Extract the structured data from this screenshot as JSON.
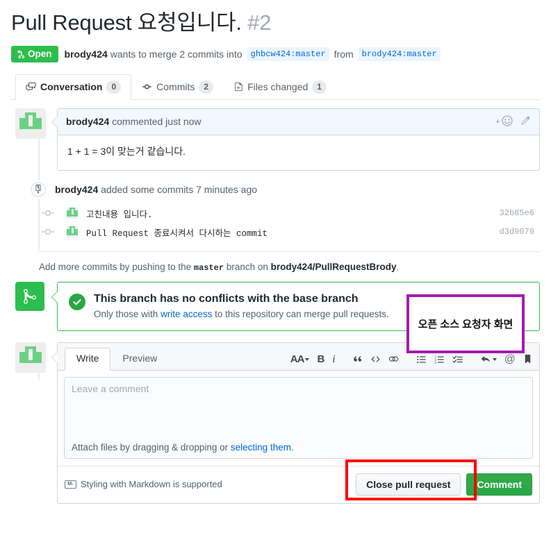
{
  "header": {
    "title": "Pull Request 요청입니다.",
    "number": "#2",
    "state": "Open",
    "state_color": "#2cbe4e",
    "author": "brody424",
    "action_text": "wants to merge 2 commits into",
    "base_branch": "ghbcw424:master",
    "from_text": "from",
    "head_branch": "brody424:master"
  },
  "tabs": [
    {
      "label": "Conversation",
      "count": "0",
      "icon": "comment-discussion-icon",
      "selected": true
    },
    {
      "label": "Commits",
      "count": "2",
      "icon": "git-commit-icon",
      "selected": false
    },
    {
      "label": "Files changed",
      "count": "1",
      "icon": "file-diff-icon",
      "selected": false
    }
  ],
  "comment": {
    "author": "brody424",
    "meta": "commented just now",
    "body": "1 + 1 = 3이 맞는거 같습니다.",
    "add_reaction": "+",
    "emoji_icon": "smiley-icon",
    "edit_icon": "pencil-icon"
  },
  "commits_event": {
    "icon": "repo-push-icon",
    "author": "brody424",
    "text": "added some commits 7 minutes ago",
    "items": [
      {
        "message": "고친내용 입니다.",
        "sha": "32b85e6"
      },
      {
        "message": "Pull Request 종료시켜서 다시하는 commit",
        "sha": "d3d9070"
      }
    ]
  },
  "add_commits_hint": {
    "prefix": "Add more commits by pushing to the",
    "branch": "master",
    "middle": "branch on",
    "repo": "brody424/PullRequestBrody",
    "suffix": "."
  },
  "merge_box": {
    "icon": "git-merge-icon",
    "check_icon": "check-icon",
    "title": "This branch has no conflicts with the base branch",
    "subtitle_before": "Only those with",
    "subtitle_link": "write access",
    "subtitle_after": "to this repository can merge pull requests.",
    "border_color": "#2cbe4e"
  },
  "annotation": {
    "note_text": "오픈 소스 요청자 화면",
    "note_color": "#a21caf",
    "highlight_color": "#ff0000"
  },
  "comment_form": {
    "tabs": [
      {
        "label": "Write",
        "selected": true
      },
      {
        "label": "Preview",
        "selected": false
      }
    ],
    "toolbar": [
      {
        "name": "heading-icon",
        "glyph": "AA",
        "caret": true
      },
      {
        "name": "bold-icon",
        "glyph": "B",
        "caret": false
      },
      {
        "name": "italic-icon",
        "glyph": "i",
        "caret": false
      },
      {
        "name": "quote-icon",
        "glyph": "“",
        "caret": false
      },
      {
        "name": "code-icon",
        "glyph": "<>",
        "caret": false
      },
      {
        "name": "link-icon",
        "glyph": "link",
        "caret": false
      },
      {
        "name": "unordered-list-icon",
        "glyph": "ul",
        "caret": false
      },
      {
        "name": "ordered-list-icon",
        "glyph": "ol",
        "caret": false
      },
      {
        "name": "task-list-icon",
        "glyph": "task",
        "caret": false
      },
      {
        "name": "reply-icon",
        "glyph": "reply",
        "caret": true
      },
      {
        "name": "mention-icon",
        "glyph": "@",
        "caret": false
      },
      {
        "name": "saved-replies-icon",
        "glyph": "bookmark",
        "caret": false
      }
    ],
    "textarea_placeholder": "Leave a comment",
    "textarea_value": "",
    "attach_before": "Attach files by dragging & dropping or",
    "attach_link": "selecting them",
    "attach_after": ".",
    "markdown_note": "Styling with Markdown is supported",
    "markdown_badge": "M↓",
    "close_button": "Close pull request",
    "comment_button": "Comment"
  }
}
